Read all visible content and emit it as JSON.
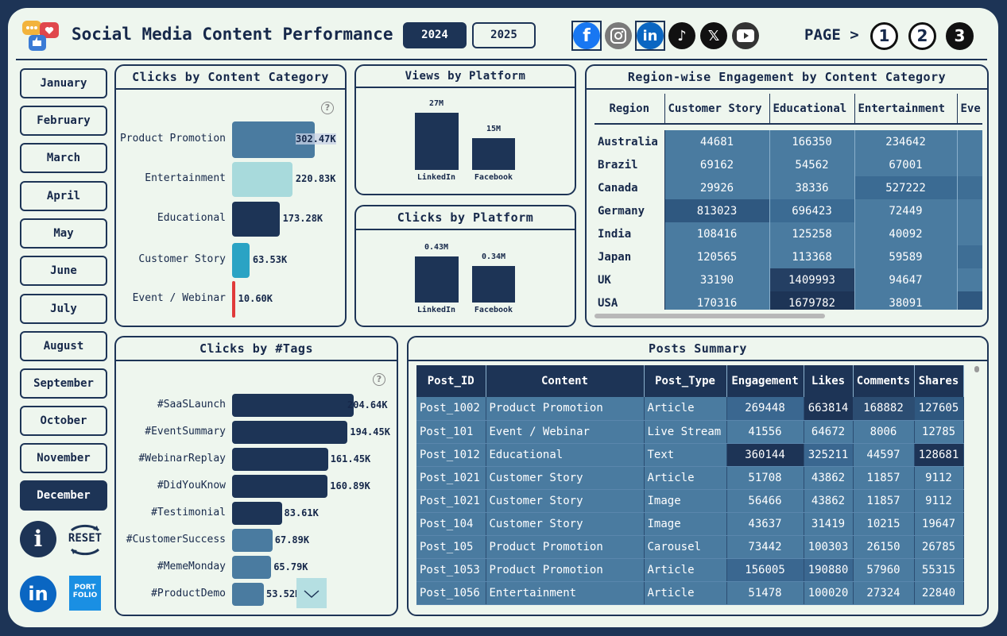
{
  "header": {
    "title": "Social Media Content Performance",
    "years": [
      "2024",
      "2025"
    ],
    "page_label": "PAGE >",
    "pages": [
      "1",
      "2",
      "3"
    ]
  },
  "social_icons": [
    "facebook-icon",
    "instagram-icon",
    "linkedin-icon",
    "tiktok-icon",
    "x-icon",
    "youtube-icon"
  ],
  "months": [
    "January",
    "February",
    "March",
    "April",
    "May",
    "June",
    "July",
    "August",
    "September",
    "October",
    "November",
    "December"
  ],
  "selected_month": "December",
  "buttons": {
    "info": "i",
    "reset": "RESET",
    "linkedin": "in",
    "portfolio": "PORT FOLIO"
  },
  "colors": {
    "navy": "#1d3456",
    "steel": "#4a7ba0",
    "teal": "#2aa3c4",
    "pale": "#a8dadc",
    "red": "#e03a3a",
    "bg": "#eef6ee"
  },
  "clicks_category": {
    "title": "Clicks by Content Category",
    "help": "?",
    "items": [
      {
        "label": "Product Promotion",
        "value": 302.47,
        "display": "302.47K",
        "color": "#4a7ba0"
      },
      {
        "label": "Entertainment",
        "value": 220.83,
        "display": "220.83K",
        "color": "#a8dadc"
      },
      {
        "label": "Educational",
        "value": 173.28,
        "display": "173.28K",
        "color": "#1d3456"
      },
      {
        "label": "Customer Story",
        "value": 63.53,
        "display": "63.53K",
        "color": "#2aa3c4"
      },
      {
        "label": "Event / Webinar",
        "value": 10.6,
        "display": "10.60K",
        "color": "#e03a3a"
      }
    ]
  },
  "views_platform": {
    "title": "Views by Platform",
    "items": [
      {
        "label": "LinkedIn",
        "value": 27,
        "display": "27M"
      },
      {
        "label": "Facebook",
        "value": 15,
        "display": "15M"
      }
    ]
  },
  "clicks_platform": {
    "title": "Clicks by Platform",
    "items": [
      {
        "label": "LinkedIn",
        "value": 0.43,
        "display": "0.43M"
      },
      {
        "label": "Facebook",
        "value": 0.34,
        "display": "0.34M"
      }
    ]
  },
  "region": {
    "title": "Region-wise Engagement by Content Category",
    "headers": [
      "Region",
      "Customer Story",
      "Educational",
      "Entertainment",
      "Eve"
    ],
    "rows": [
      [
        "Australia",
        "44681",
        "166350",
        "234642"
      ],
      [
        "Brazil",
        "69162",
        "54562",
        "67001"
      ],
      [
        "Canada",
        "29926",
        "38336",
        "527222"
      ],
      [
        "Germany",
        "813023",
        "696423",
        "72449"
      ],
      [
        "India",
        "108416",
        "125258",
        "40092"
      ],
      [
        "Japan",
        "120565",
        "113368",
        "59589"
      ],
      [
        "UK",
        "33190",
        "1409993",
        "94647"
      ],
      [
        "USA",
        "170316",
        "1679782",
        "38091"
      ]
    ]
  },
  "tags": {
    "title": "Clicks by #Tags",
    "help": "?",
    "items": [
      {
        "label": "#SaaSLaunch",
        "value": 204.64,
        "display": "204.64K"
      },
      {
        "label": "#EventSummary",
        "value": 194.45,
        "display": "194.45K"
      },
      {
        "label": "#WebinarReplay",
        "value": 161.45,
        "display": "161.45K"
      },
      {
        "label": "#DidYouKnow",
        "value": 160.89,
        "display": "160.89K"
      },
      {
        "label": "#Testimonial",
        "value": 83.61,
        "display": "83.61K"
      },
      {
        "label": "#CustomerSuccess",
        "value": 67.89,
        "display": "67.89K"
      },
      {
        "label": "#MemeMonday",
        "value": 65.79,
        "display": "65.79K"
      },
      {
        "label": "#ProductDemo",
        "value": 53.52,
        "display": "53.52K"
      }
    ]
  },
  "posts": {
    "title": "Posts Summary",
    "headers": [
      "Post_ID",
      "Content",
      "Post_Type",
      "Engagement",
      "Likes",
      "Comments",
      "Shares"
    ],
    "rows": [
      [
        "Post_1002",
        "Product Promotion",
        "Article",
        "269448",
        "663814",
        "168882",
        "127605"
      ],
      [
        "Post_101",
        "Event / Webinar",
        "Live Stream",
        "41556",
        "64672",
        "8006",
        "12785"
      ],
      [
        "Post_1012",
        "Educational",
        "Text",
        "360144",
        "325211",
        "44597",
        "128681"
      ],
      [
        "Post_1021",
        "Customer Story",
        "Article",
        "51708",
        "43862",
        "11857",
        "9112"
      ],
      [
        "Post_1021",
        "Customer Story",
        "Image",
        "56466",
        "43862",
        "11857",
        "9112"
      ],
      [
        "Post_104",
        "Customer Story",
        "Image",
        "43637",
        "31419",
        "10215",
        "19647"
      ],
      [
        "Post_105",
        "Product Promotion",
        "Carousel",
        "73442",
        "100303",
        "26150",
        "26785"
      ],
      [
        "Post_1053",
        "Product Promotion",
        "Article",
        "156005",
        "190880",
        "57960",
        "55315"
      ],
      [
        "Post_1056",
        "Entertainment",
        "Article",
        "51478",
        "100020",
        "27324",
        "22840"
      ]
    ]
  }
}
